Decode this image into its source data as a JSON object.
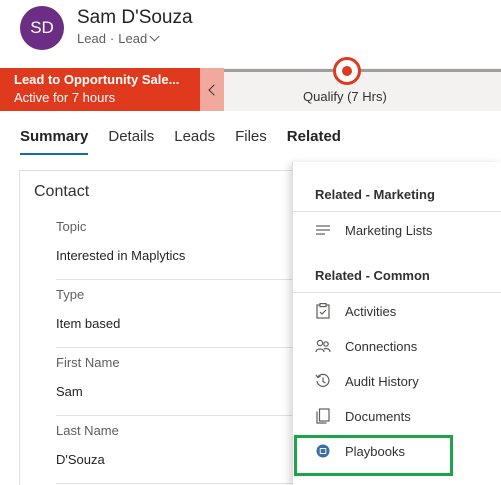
{
  "record": {
    "initials": "SD",
    "name": "Sam D'Souza",
    "entity": "Lead",
    "separator": "·",
    "form": "Lead"
  },
  "process": {
    "name": "Lead to Opportunity Sale...",
    "duration": "Active for 7 hours",
    "stage_label": "Qualify  (7 Hrs)"
  },
  "tabs": [
    {
      "label": "Summary",
      "active": true
    },
    {
      "label": "Details"
    },
    {
      "label": "Leads"
    },
    {
      "label": "Files"
    },
    {
      "label": "Related"
    }
  ],
  "form": {
    "section_title": "Contact",
    "fields": [
      {
        "label": "Topic",
        "value": "Interested in Maplytics"
      },
      {
        "label": "Type",
        "value": "Item based"
      },
      {
        "label": "First Name",
        "value": "Sam"
      },
      {
        "label": "Last Name",
        "value": "D'Souza"
      }
    ]
  },
  "related_menu": {
    "marketing_header": "Related - Marketing",
    "marketing_items": [
      {
        "label": "Marketing Lists",
        "icon": "list-icon"
      }
    ],
    "common_header": "Related - Common",
    "common_items": [
      {
        "label": "Activities",
        "icon": "clipboard-icon"
      },
      {
        "label": "Connections",
        "icon": "people-icon"
      },
      {
        "label": "Audit History",
        "icon": "history-icon"
      },
      {
        "label": "Documents",
        "icon": "documents-icon"
      },
      {
        "label": "Playbooks",
        "icon": "playbook-icon"
      }
    ]
  },
  "colors": {
    "accent": "#0f6cbd",
    "process_active": "#e03a1e",
    "avatar": "#6b2e84",
    "highlight": "#1da448"
  }
}
